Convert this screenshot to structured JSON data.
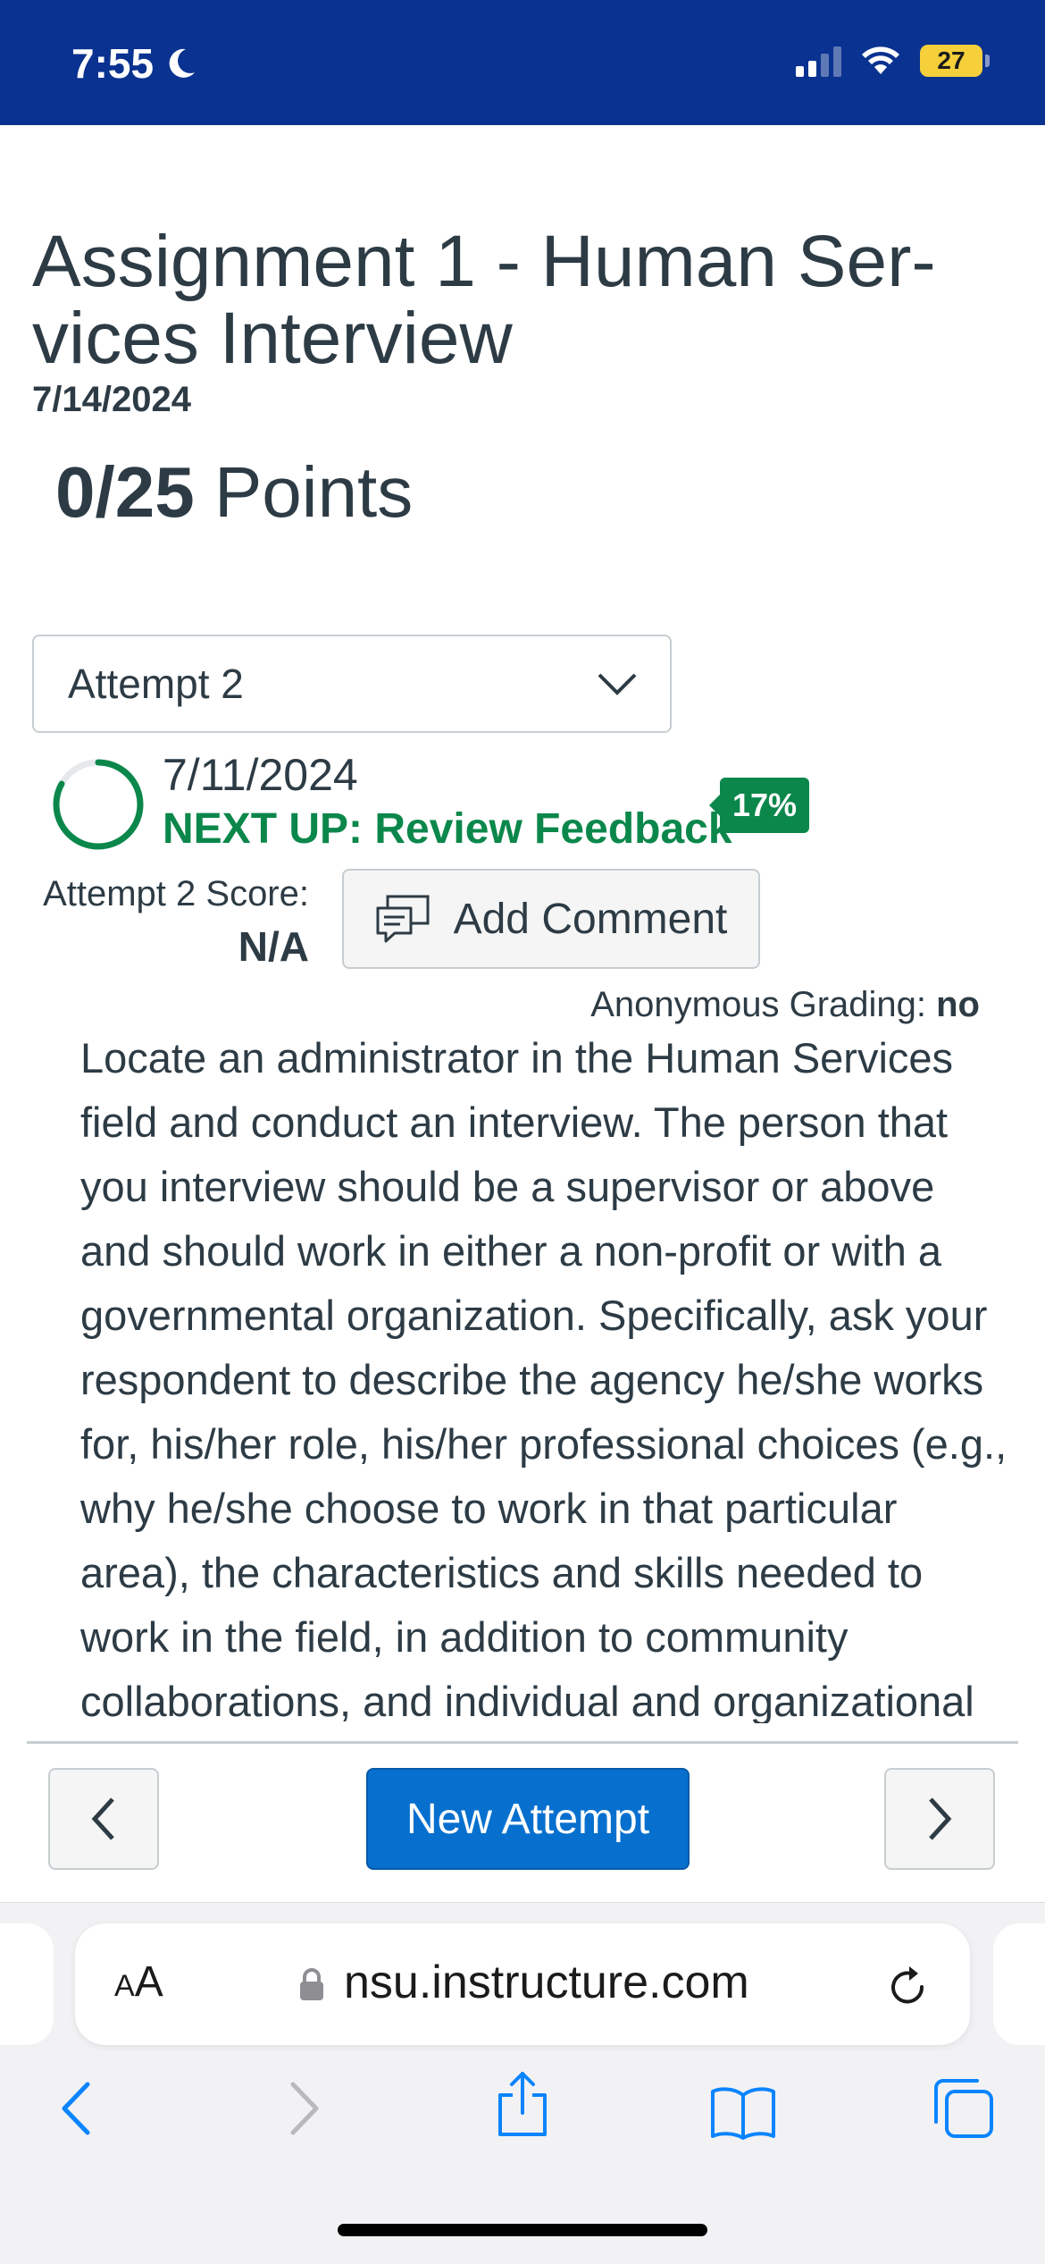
{
  "status_bar": {
    "time": "7:55",
    "battery": "27",
    "colors": {
      "background": "#0a3290"
    }
  },
  "assignment": {
    "title": "Assignment 1 - Human Ser- vices Interview",
    "due_date": "7/14/2024",
    "points_earned": "0/25",
    "points_label": "Points"
  },
  "attempt": {
    "selected": "Attempt 2",
    "date": "7/11/2024",
    "next_up": "NEXT UP: Review Feedback",
    "progress_badge": "17%",
    "progress_value": 0.83,
    "score_label": "Attempt 2 Score:",
    "score_value": "N/A",
    "add_comment_label": "Add Comment",
    "anonymous_label": "Anonymous Grading:",
    "anonymous_value": "no"
  },
  "description": "Locate an administrator in the Human Services field and conduct an interview. The person that you interview should be a supervisor or above and should work in either a non-profit or with a governmental organization.  Specifically, ask your respondent to describe the agency he/she works for, his/her role, his/her professional choices (e.g., why he/she choose to work in that particular area), the characteristics and skills needed to work in the field, in addition to community collaborations, and individual and organizational",
  "footer": {
    "new_attempt_label": "New Attempt",
    "prev_icon": "chevron-left-icon",
    "next_icon": "chevron-right-icon"
  },
  "browser": {
    "aa_label_big": "A",
    "aa_label_small": "A",
    "url": "nsu.instructure.com",
    "colors": {
      "accent": "#0a84ff"
    }
  },
  "colors": {
    "text": "#2d3b45",
    "success": "#0b874b",
    "primary_button": "#0770ce"
  }
}
